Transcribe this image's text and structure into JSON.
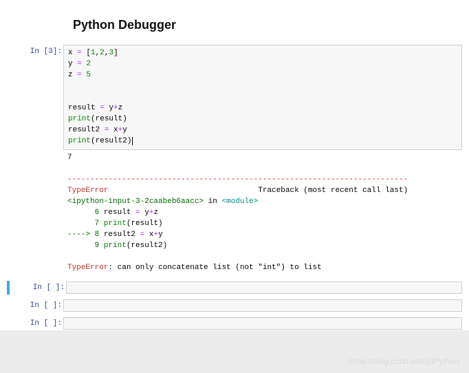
{
  "heading": "Python Debugger",
  "cell_in": {
    "prompt": "In [3]:",
    "code": {
      "l1_a": "x ",
      "l1_b": "=",
      "l1_c": " [",
      "l1_d": "1",
      "l1_e": ",",
      "l1_f": "2",
      "l1_g": ",",
      "l1_h": "3",
      "l1_i": "]",
      "l2_a": "y ",
      "l2_b": "=",
      "l2_c": " ",
      "l2_d": "2",
      "l3_a": "z ",
      "l3_b": "=",
      "l3_c": " ",
      "l3_d": "5",
      "blank": "",
      "l5_a": "result ",
      "l5_b": "=",
      "l5_c": " y",
      "l5_d": "+",
      "l5_e": "z",
      "l6_a": "print",
      "l6_b": "(result)",
      "l7_a": "result2 ",
      "l7_b": "=",
      "l7_c": " x",
      "l7_d": "+",
      "l7_e": "y",
      "l8_a": "print",
      "l8_b": "(result2)"
    }
  },
  "output": {
    "stdout": "7",
    "sep": "---------------------------------------------------------------------------",
    "err_type": "TypeError",
    "tb_label": "                                 Traceback (most recent call last)",
    "src_tag": "<ipython-input-3-2caabeb6aacc>",
    "in_word": " in ",
    "mod_tag": "<module>",
    "tb_l1_a": "      6",
    "tb_l1_b": " result ",
    "tb_l1_c": "=",
    "tb_l1_d": " y",
    "tb_l1_e": "+",
    "tb_l1_f": "z",
    "tb_l2_a": "      7",
    "tb_l2_b": " ",
    "tb_l2_c": "print",
    "tb_l2_d": "(result)",
    "tb_arrow": "----> ",
    "tb_l3_a": "8",
    "tb_l3_b": " result2 ",
    "tb_l3_c": "=",
    "tb_l3_d": " x",
    "tb_l3_e": "+",
    "tb_l3_f": "y",
    "tb_l4_a": "      9",
    "tb_l4_b": " ",
    "tb_l4_c": "print",
    "tb_l4_d": "(result2)",
    "err_final_type": "TypeError",
    "err_final_msg": ": can only concatenate list (not \"int\") to list"
  },
  "empty_prompt": "In [ ]:",
  "watermark": "https://blog.csdn.net/qdPython"
}
